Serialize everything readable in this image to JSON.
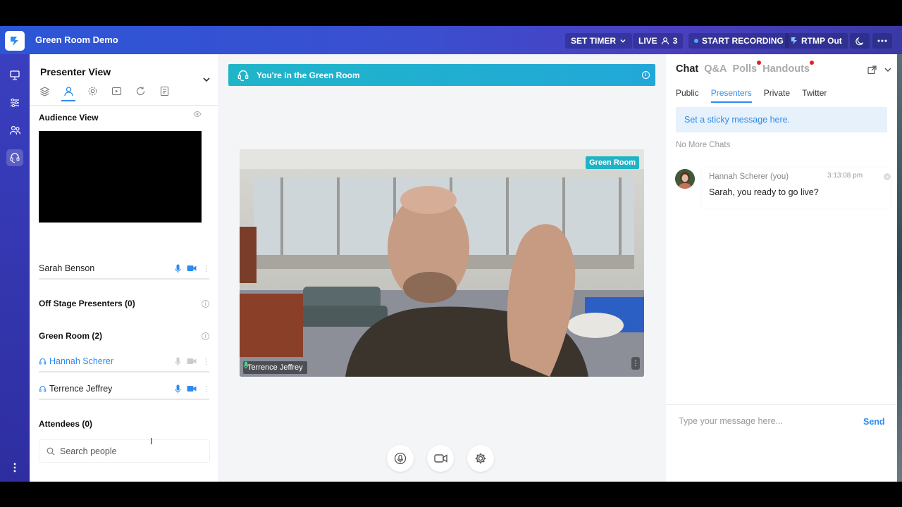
{
  "topbar": {
    "title": "Green Room Demo",
    "set_timer": "SET TIMER",
    "live": "LIVE",
    "viewer_count": "3",
    "start_recording": "START RECORDING",
    "rtmp": "RTMP Out"
  },
  "presenter_panel": {
    "title": "Presenter View",
    "audience_view_label": "Audience View",
    "on_stage": [
      {
        "name": "Sarah Benson"
      }
    ],
    "off_stage_label": "Off Stage Presenters (0)",
    "green_room_label": "Green Room (2)",
    "green_room": [
      {
        "name": "Hannah Scherer"
      },
      {
        "name": "Terrence Jeffrey"
      }
    ],
    "attendees_label": "Attendees (0)",
    "search_placeholder": "Search people"
  },
  "stage": {
    "banner": "You're in the Green Room",
    "video_badge": "Green Room",
    "video_name": "Terrence Jeffrey"
  },
  "chat": {
    "tabs": [
      "Chat",
      "Q&A",
      "Polls",
      "Handouts"
    ],
    "subtabs": [
      "Public",
      "Presenters",
      "Private",
      "Twitter"
    ],
    "sticky_placeholder": "Set a sticky message here.",
    "no_more": "No More Chats",
    "message": {
      "author": "Hannah Scherer (you)",
      "time": "3:13:08 pm",
      "text": "Sarah, you ready to go live?"
    },
    "input_placeholder": "Type your message here...",
    "send": "Send"
  },
  "colors": {
    "accent": "#2d8cf0",
    "banner": "#1fb5c9",
    "topbar": "#2c56d6",
    "rail": "#3a3fbf",
    "notification": "#e02020"
  }
}
